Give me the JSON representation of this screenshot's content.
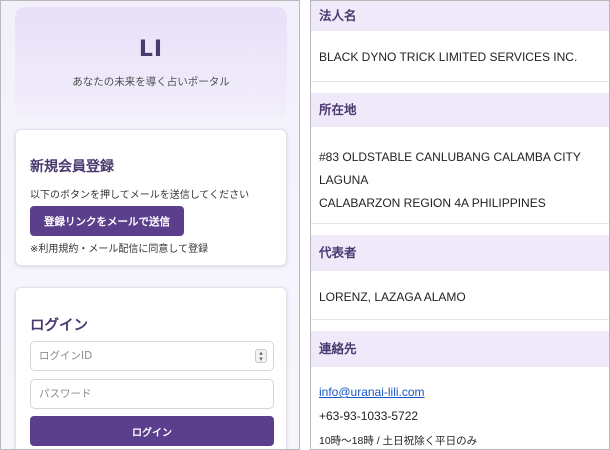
{
  "left": {
    "hero": {
      "title": "LI",
      "subtitle": "あなたの未来を導く占いポータル"
    },
    "register": {
      "heading": "新規会員登録",
      "description": "以下のボタンを押してメールを送信してください",
      "button_label": "登録リンクをメールで送信",
      "note": "※利用規約・メール配信に同意して登録"
    },
    "login": {
      "heading": "ログイン",
      "id_placeholder": "ログインID",
      "password_placeholder": "パスワード",
      "button_label": "ログイン"
    }
  },
  "right": {
    "company_name": {
      "heading": "法人名",
      "value": "BLACK DYNO TRICK LIMITED SERVICES INC."
    },
    "address": {
      "heading": "所在地",
      "lines": [
        "#83 OLDSTABLE CANLUBANG CALAMBA CITY",
        "LAGUNA",
        "CALABARZON REGION 4A PHILIPPINES"
      ]
    },
    "representative": {
      "heading": "代表者",
      "value": "LORENZ, LAZAGA ALAMO"
    },
    "contact": {
      "heading": "連絡先",
      "email": "info@uranai-lili.com",
      "phone": "+63-93-1033-5722",
      "hours": "10時〜18時 / 土日祝除く平日のみ"
    }
  }
}
